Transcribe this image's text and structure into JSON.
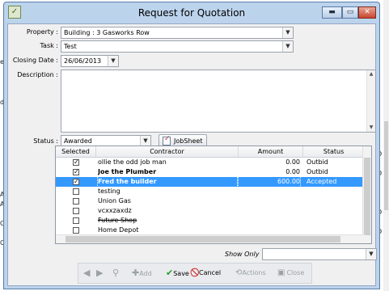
{
  "window": {
    "title": "Request for Quotation"
  },
  "form": {
    "property_label": "Property :",
    "property_value": "Building : 3 Gasworks Row",
    "task_label": "Task :",
    "task_value": "Test",
    "closing_label": "Closing Date :",
    "closing_value": "26/06/2013",
    "description_label": "Description :",
    "status_label": "Status :",
    "status_value": "Awarded",
    "jobsheet_label": "JobSheet"
  },
  "grid": {
    "columns": [
      "Selected",
      "Contractor",
      "Amount",
      "Status"
    ],
    "rows": [
      {
        "selected": true,
        "contractor": "ollie the odd job man",
        "amount": "0.00",
        "status": "Outbid",
        "bold": false,
        "strike": false
      },
      {
        "selected": true,
        "contractor": "Joe the Plumber",
        "amount": "0.00",
        "status": "Outbid",
        "bold": true,
        "strike": false
      },
      {
        "selected": true,
        "contractor": "Fred the builder",
        "amount": "600.00",
        "status": "Accepted",
        "bold": true,
        "strike": false,
        "highlighted": true
      },
      {
        "selected": false,
        "contractor": "testing",
        "amount": "",
        "status": "",
        "bold": false,
        "strike": false
      },
      {
        "selected": false,
        "contractor": "Union Gas",
        "amount": "",
        "status": "",
        "bold": false,
        "strike": false
      },
      {
        "selected": false,
        "contractor": "vcxxzaxdz",
        "amount": "",
        "status": "",
        "bold": false,
        "strike": false
      },
      {
        "selected": false,
        "contractor": "Future Shop",
        "amount": "",
        "status": "",
        "bold": false,
        "strike": true
      },
      {
        "selected": false,
        "contractor": "Home Depot",
        "amount": "",
        "status": "",
        "bold": false,
        "strike": false
      }
    ]
  },
  "show_only_label": "Show Only",
  "toolbar": {
    "add": "Add",
    "save": "Save",
    "cancel": "Cancel",
    "actions": "Actions",
    "close": "Close"
  },
  "background": {
    "left_fragments": [
      "e",
      "d",
      "Ac",
      "Ac",
      "Or",
      "Or"
    ],
    "right_fragments": [
      "D",
      "D",
      "D",
      "D"
    ]
  },
  "colors": {
    "selection": "#3399ff",
    "title_bar": "#bcd3ec",
    "save_icon": "#2e9a2e",
    "cancel_icon": "#d02020"
  }
}
